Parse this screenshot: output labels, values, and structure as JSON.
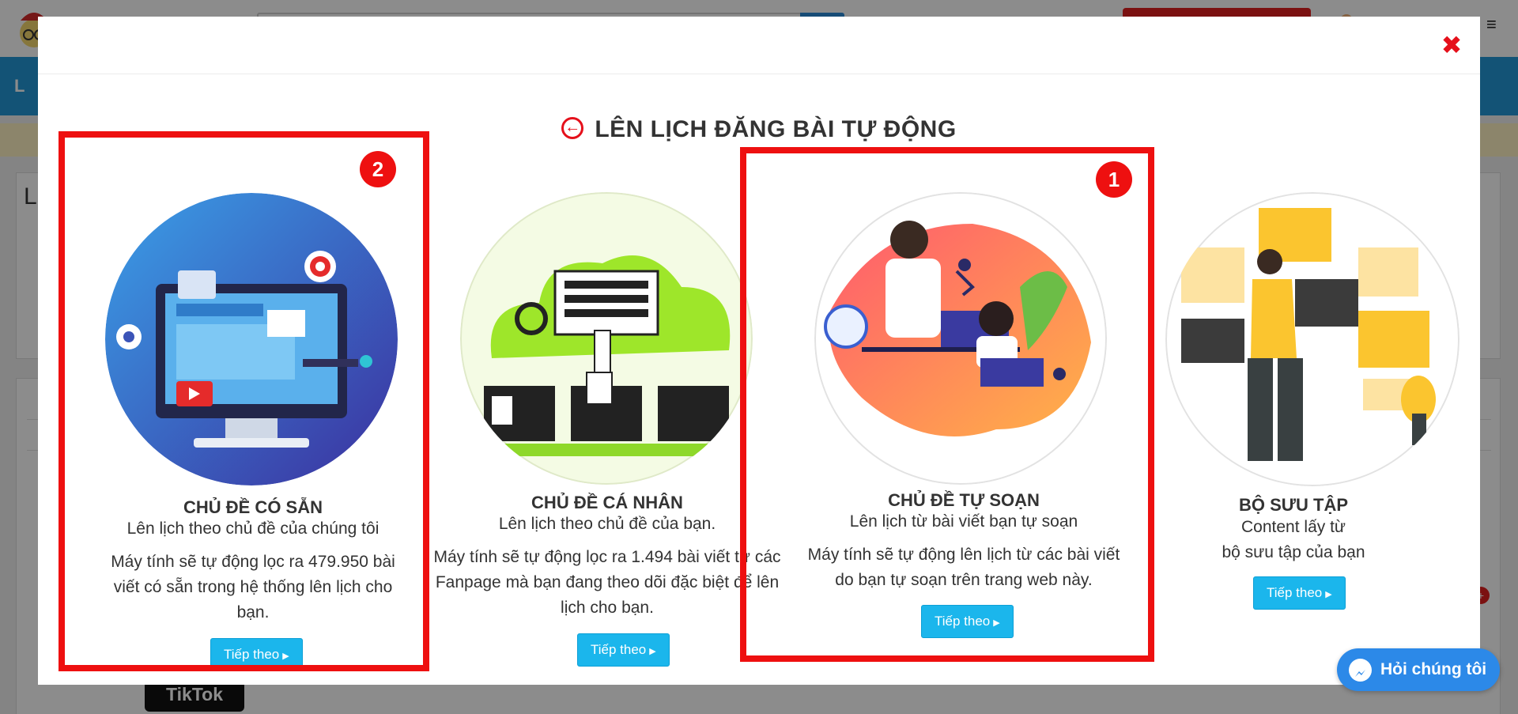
{
  "background": {
    "blue_bar_text": "L",
    "panel_text": "L",
    "tiktok_label": "TikTok",
    "notif_badge": "+",
    "menu_icon": "hamburger-icon"
  },
  "modal": {
    "close_label": "✖",
    "title": "LÊN LỊCH ĐĂNG BÀI TỰ ĐỘNG",
    "title_icon": "arrow-left-circle-icon",
    "cards": [
      {
        "title": "CHỦ ĐỀ CÓ SẴN",
        "subtitle": "Lên lịch theo chủ đề của chúng tôi",
        "description": "Máy tính sẽ tự động lọc ra 479.950 bài viết có sẵn trong hệ thống lên lịch cho bạn.",
        "button": "Tiếp theo",
        "badge": "2"
      },
      {
        "title": "CHỦ ĐỀ CÁ NHÂN",
        "subtitle": "Lên lịch theo chủ đề của bạn.",
        "description": "Máy tính sẽ tự động lọc ra 1.494 bài viết từ các Fanpage mà bạn đang theo dõi đặc biệt để lên lịch cho bạn.",
        "button": "Tiếp theo"
      },
      {
        "title": "CHỦ ĐỀ TỰ SOẠN",
        "subtitle": "Lên lịch từ bài viết bạn tự soạn",
        "description": "Máy tính sẽ tự động lên lịch từ các bài viết do bạn tự soạn trên trang web này.",
        "button": "Tiếp theo",
        "badge": "1"
      },
      {
        "title": "BỘ SƯU TẬP",
        "subtitle": "Content lấy từ",
        "subtitle2": "bộ sưu tập của bạn",
        "button": "Tiếp theo"
      }
    ]
  },
  "chat": {
    "label": "Hỏi chúng tôi",
    "icon": "messenger-icon"
  },
  "colors": {
    "accent_red": "#ee1010",
    "button_blue": "#1bb6ec",
    "chat_blue": "#2c89e8"
  }
}
